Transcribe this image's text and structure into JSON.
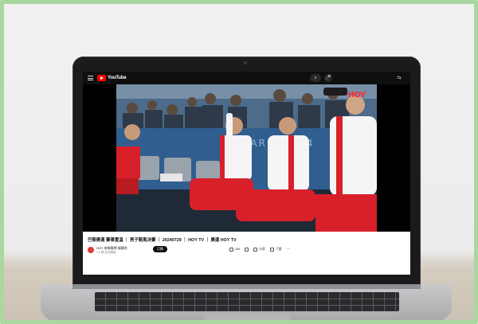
{
  "youtube": {
    "logo_text": "YouTube",
    "search_glyph": "⌕",
    "mic_glyph": "🎤",
    "cast_glyph": "⇆"
  },
  "video": {
    "broadcaster_badge": "HOY",
    "title": "巴黎奧運 賽事重溫 ｜ 男子鞍馬決賽 ｜ 20240729 ｜ HOY TV ｜ 奧運 HOY TV",
    "channel_name": "HOY 有線電視 娛樂台",
    "channel_subs": "1.5 萬 位訂閱者",
    "subscribe_label": "訂閱",
    "actions": [
      {
        "icon": "like-icon",
        "label": "166"
      },
      {
        "icon": "dislike-icon",
        "label": ""
      },
      {
        "icon": "share-icon",
        "label": "分享"
      },
      {
        "icon": "download-icon",
        "label": "下載"
      }
    ],
    "more_glyph": "···"
  },
  "colors": {
    "frame_border": "#a8d8a0",
    "youtube_red": "#ff0000",
    "hoy_red": "#ff2a2a",
    "team_red": "#d8202a"
  }
}
